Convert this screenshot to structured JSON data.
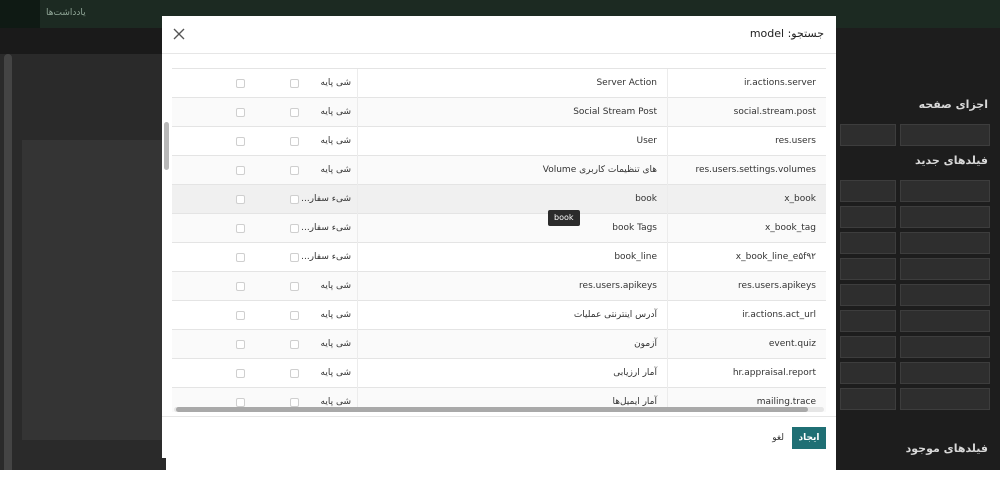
{
  "background": {
    "topbar_note": "یادداشت‌ها",
    "right_panel": {
      "section_page_parts": "اجزای صفحه",
      "section_new_fields": "فیلدهای جدید",
      "section_existing_fields": "فیلدهای موجود"
    }
  },
  "modal": {
    "title": "جستجو: model",
    "close_icon": "close-icon",
    "tooltip": "book",
    "rows": [
      {
        "model": "ir.actions.server",
        "name": "Server Action",
        "type": "شی پایه"
      },
      {
        "model": "social.stream.post",
        "name": "Social Stream Post",
        "type": "شی پایه"
      },
      {
        "model": "res.users",
        "name": "User",
        "type": "شی پایه"
      },
      {
        "model": "res.users.settings.volumes",
        "name": "Volume های تنظیمات کاربری",
        "type": "شی پایه"
      },
      {
        "model": "x_book",
        "name": "book",
        "type": "شیء سفار..."
      },
      {
        "model": "x_book_tag",
        "name": "book Tags",
        "type": "شیء سفار..."
      },
      {
        "model": "x_book_line_e۵f۹۲",
        "name": "book_line",
        "type": "شیء سفار..."
      },
      {
        "model": "res.users.apikeys",
        "name": "res.users.apikeys",
        "type": "شی پایه"
      },
      {
        "model": "ir.actions.act_url",
        "name": "آدرس اینترنتی عملیات",
        "type": "شی پایه"
      },
      {
        "model": "event.quiz",
        "name": "آزمون",
        "type": "شی پایه"
      },
      {
        "model": "hr.appraisal.report",
        "name": "آمار ارزیابی",
        "type": "شی پایه"
      },
      {
        "model": "mailing.trace",
        "name": "آمار ایمیل‌ها",
        "type": "شی پایه"
      }
    ],
    "footer": {
      "create_label": "ایجاد",
      "cancel_label": "لغو"
    }
  },
  "colors": {
    "primary": "#1f6f74",
    "backdrop": "#1c1c1c"
  }
}
